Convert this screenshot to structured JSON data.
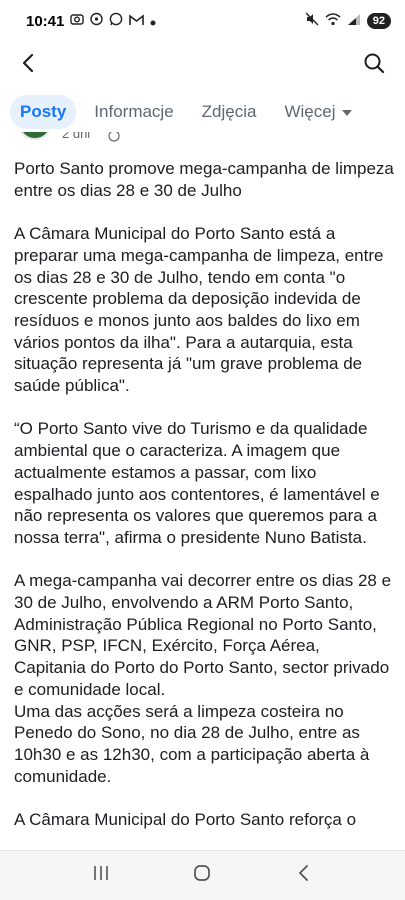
{
  "status_bar": {
    "time": "10:41",
    "left_icons": [
      "camera-icon",
      "notification-icon",
      "whatsapp-icon",
      "gmail-icon",
      "dot-icon"
    ],
    "right_icons": [
      "mute-icon",
      "wifi-icon",
      "signal-icon"
    ],
    "battery": "92"
  },
  "header": {
    "back_icon": "back-arrow-icon",
    "search_icon": "search-icon"
  },
  "tabs": [
    {
      "label": "Posty",
      "active": true
    },
    {
      "label": "Informacje",
      "active": false
    },
    {
      "label": "Zdjęcia",
      "active": false
    },
    {
      "label": "Więcej",
      "active": false
    }
  ],
  "post": {
    "time": "2 dni",
    "paragraphs": [
      "Porto Santo promove mega-campanha de limpeza entre os dias 28 e 30 de Julho",
      "A Câmara Municipal do Porto Santo está a preparar uma mega-campanha de limpeza, entre os dias 28 e 30 de Julho, tendo em conta \"o  crescente problema da deposição indevida de resíduos e monos junto aos baldes do lixo em vários pontos da ilha\". Para a autarquia, esta situação representa já \"um grave problema de saúde pública\".",
      "“O Porto Santo vive do Turismo e da qualidade ambiental que o caracteriza. A imagem que actualmente estamos a passar, com lixo espalhado junto aos contentores, é lamentável e não representa os valores que queremos para a nossa terra\", afirma o presidente Nuno Batista.",
      "A mega-campanha vai decorrer entre os dias 28 e 30 de Julho, envolvendo a ARM Porto Santo, Administração Pública Regional no Porto Santo, GNR, PSP, IFCN, Exército, Força Aérea, Capitania do Porto do Porto Santo, sector privado e comunidade local.\nUma das acções será a limpeza costeira no Penedo do Sono, no dia 28 de Julho, entre as 10h30 e as 12h30, com a participação aberta à comunidade.",
      "A Câmara Municipal do Porto Santo reforça o"
    ]
  },
  "nav_bar": {
    "recents_icon": "recent-apps-icon",
    "home_icon": "home-icon",
    "back_icon": "nav-back-icon"
  }
}
